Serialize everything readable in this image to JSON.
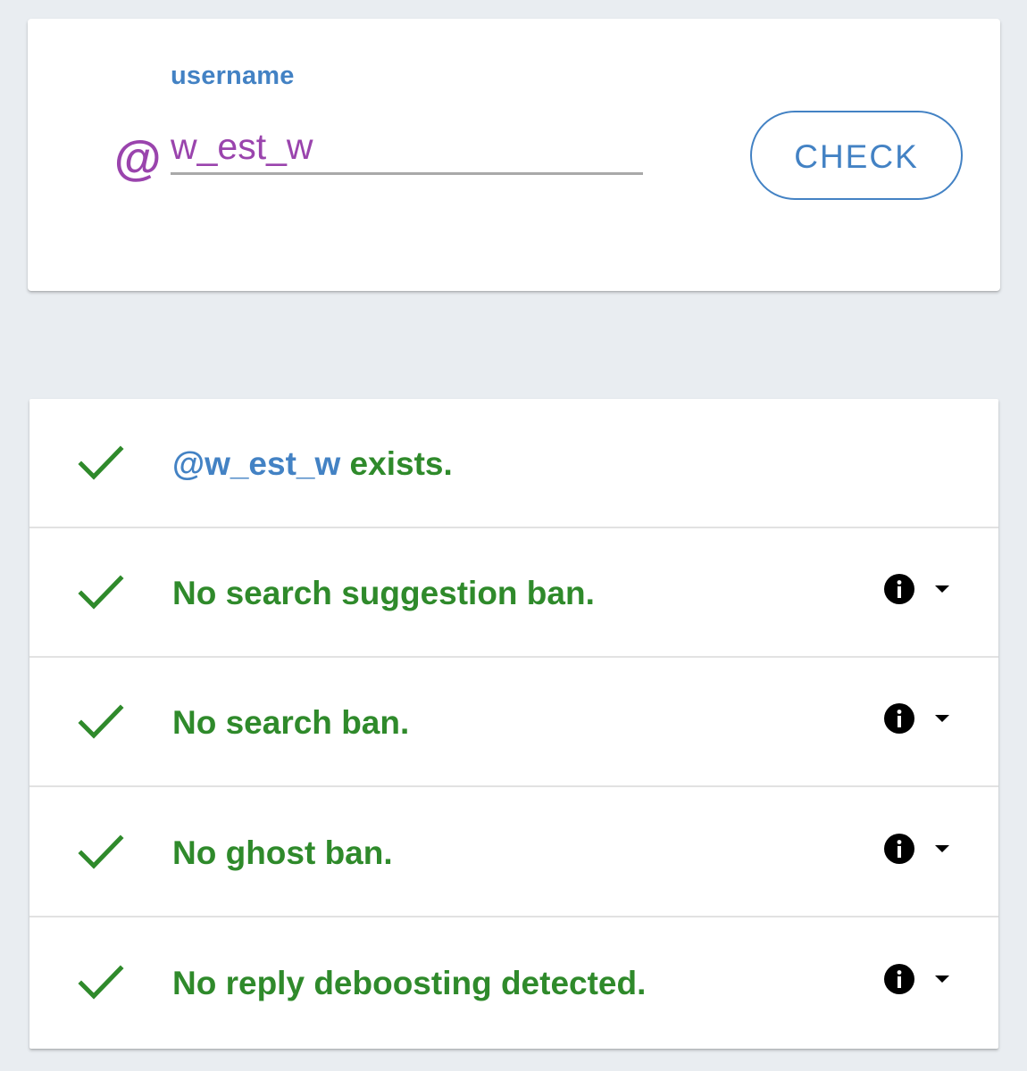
{
  "search": {
    "at_symbol": "@",
    "label": "username",
    "value": "w_est_w",
    "button_label": "CHECK"
  },
  "results": [
    {
      "mention": "@w_est_w",
      "text": " exists.",
      "status": "pass",
      "has_info": false
    },
    {
      "mention": "",
      "text": "No search suggestion ban.",
      "status": "pass",
      "has_info": true
    },
    {
      "mention": "",
      "text": "No search ban.",
      "status": "pass",
      "has_info": true
    },
    {
      "mention": "",
      "text": "No ghost ban.",
      "status": "pass",
      "has_info": true
    },
    {
      "mention": "",
      "text": "No reply deboosting detected.",
      "status": "pass",
      "has_info": true
    }
  ],
  "colors": {
    "accent": "#4382c4",
    "username": "#9a44ad",
    "success": "#2f8a2b",
    "background": "#e9edf1"
  },
  "icons": {
    "status_icon": "check-icon",
    "info_icon": "info-icon",
    "expand_icon": "caret-down-icon"
  }
}
